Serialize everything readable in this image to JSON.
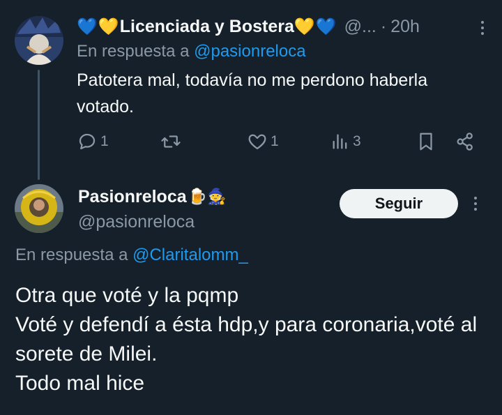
{
  "reply1": {
    "name_prefix_emoji": "💙💛",
    "display_name": "Licenciada y Bostera",
    "name_suffix_emoji": "💛💙",
    "handle_truncated": "@...",
    "separator": "·",
    "time": "20h",
    "replying_label": "En respuesta a ",
    "replying_to": "@pasionreloca",
    "text": "Patotera mal, todavía no me perdono haberla votado.",
    "actions": {
      "replies": "1",
      "reposts": "",
      "likes": "1",
      "views": "3"
    }
  },
  "main_tweet": {
    "display_name": "Pasionreloca",
    "name_emoji": "🍺🧙",
    "handle": "@pasionreloca",
    "follow_label": "Seguir",
    "replying_label": "En respuesta a ",
    "replying_to": "@Claritalomm_",
    "text": "Otra que voté y la pqmp\nVoté y defendí a ésta hdp,y para coronaria,voté al sorete de Milei.\nTodo mal hice"
  },
  "icons": [
    "avatar",
    "more-icon",
    "reply-icon",
    "repost-icon",
    "like-icon",
    "views-icon",
    "bookmark-icon",
    "share-icon"
  ],
  "colors": {
    "background": "#15202b",
    "text": "#f7f9f9",
    "secondary": "#8b98a5",
    "accent": "#1d9bf0",
    "thread_line": "#425364",
    "button_bg": "#eff3f4"
  }
}
